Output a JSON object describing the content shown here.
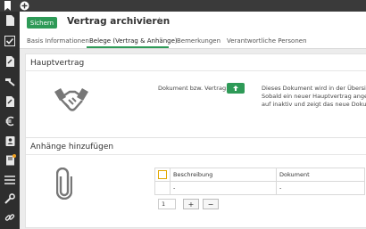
{
  "topbar": {
    "bookmark_icon": "bookmark-icon",
    "add_icon": "plus-circle-icon"
  },
  "sidebar": {
    "items": [
      {
        "icon": "document-icon"
      },
      {
        "icon": "checkbox-icon"
      },
      {
        "icon": "file-edit-icon"
      },
      {
        "icon": "hammer-icon"
      },
      {
        "icon": "file-edit-icon"
      },
      {
        "icon": "euro-icon"
      },
      {
        "icon": "badge-icon"
      },
      {
        "icon": "book-icon",
        "badge": true
      },
      {
        "icon": "list-icon"
      },
      {
        "icon": "wrench-icon"
      },
      {
        "icon": "link-icon"
      }
    ]
  },
  "header": {
    "save_label": "Sichern",
    "title": "Vertrag archivieren",
    "star": "☆"
  },
  "tabs": [
    "Basis Informationen",
    "Belege (Vertrag & Anhänge)",
    "Bemerkungen",
    "Verantwortliche Personen"
  ],
  "hauptvertrag": {
    "title": "Hauptvertrag",
    "doc_label": "Dokument bzw. Vertrag:",
    "description_lines": [
      "Dieses Dokument wird in der Übersicht",
      "Sobald ein neuer Hauptvertrag angehän",
      "auf inaktiv und zeigt das neue Dokumen"
    ]
  },
  "anhaenge": {
    "title": "Anhänge hinzufügen",
    "columns": [
      "Beschreibung",
      "Dokument"
    ],
    "row": [
      "-",
      "-"
    ],
    "quantity": "1",
    "plus": "+",
    "minus": "−"
  },
  "colors": {
    "accent": "#2e9a57",
    "sidebar": "#2e2e2e",
    "topbar": "#3a3a3a"
  }
}
